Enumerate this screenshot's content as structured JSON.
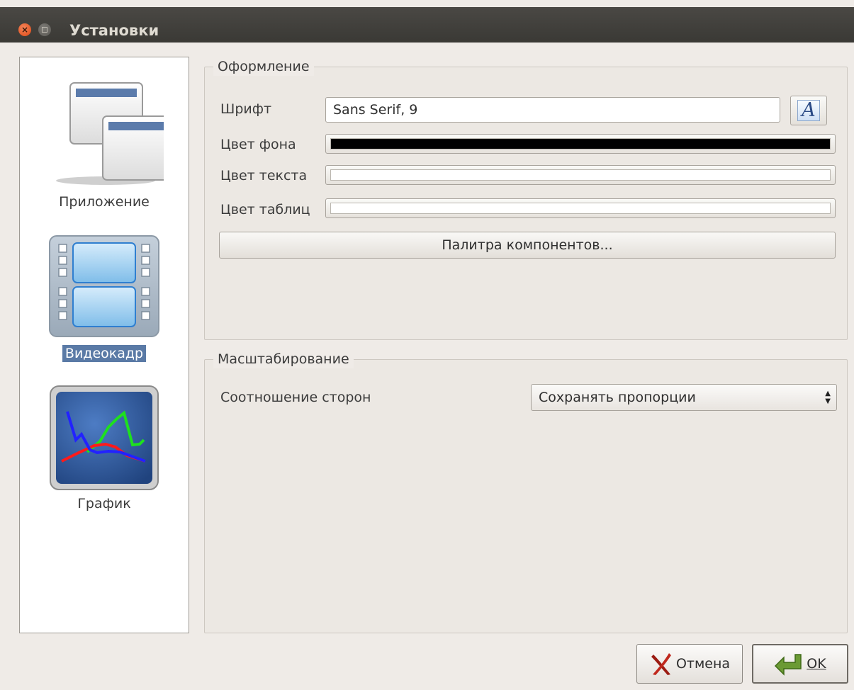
{
  "window": {
    "title": "Установки"
  },
  "sidebar": {
    "items": [
      {
        "label": "Приложение",
        "icon": "application-windows-icon",
        "selected": false
      },
      {
        "label": "Видеокадр",
        "icon": "film-frame-icon",
        "selected": true
      },
      {
        "label": "График",
        "icon": "chart-graph-icon",
        "selected": false
      }
    ]
  },
  "appearance": {
    "title": "Оформление",
    "font_label": "Шрифт",
    "font_value": "Sans Serif, 9",
    "font_button_glyph": "A",
    "bg_color_label": "Цвет фона",
    "bg_color": "#000000",
    "text_color_label": "Цвет текста",
    "text_color": "#ffffff",
    "table_color_label": "Цвет таблиц",
    "table_color": "#ffffff",
    "palette_button": "Палитра компонентов..."
  },
  "scaling": {
    "title": "Масштабирование",
    "aspect_label": "Соотношение сторон",
    "aspect_value": "Сохранять пропорции"
  },
  "buttons": {
    "cancel": "Отмена",
    "ok": "OK"
  }
}
